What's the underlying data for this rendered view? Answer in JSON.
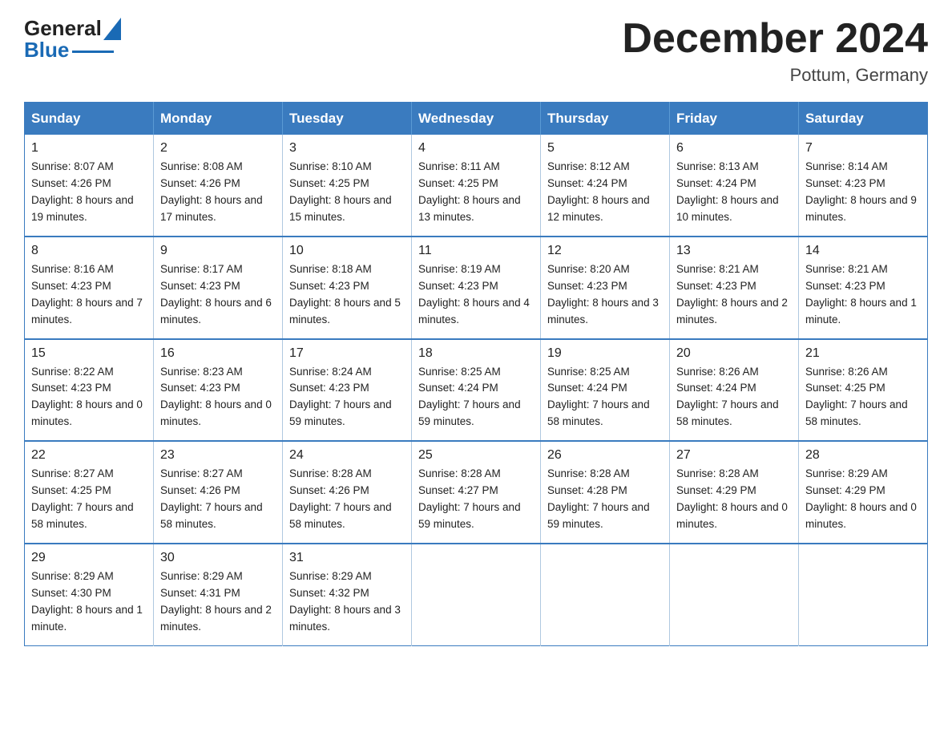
{
  "header": {
    "logo_general": "General",
    "logo_blue": "Blue",
    "month_title": "December 2024",
    "location": "Pottum, Germany"
  },
  "days_of_week": [
    "Sunday",
    "Monday",
    "Tuesday",
    "Wednesday",
    "Thursday",
    "Friday",
    "Saturday"
  ],
  "weeks": [
    [
      {
        "day": "1",
        "sunrise": "8:07 AM",
        "sunset": "4:26 PM",
        "daylight": "8 hours and 19 minutes."
      },
      {
        "day": "2",
        "sunrise": "8:08 AM",
        "sunset": "4:26 PM",
        "daylight": "8 hours and 17 minutes."
      },
      {
        "day": "3",
        "sunrise": "8:10 AM",
        "sunset": "4:25 PM",
        "daylight": "8 hours and 15 minutes."
      },
      {
        "day": "4",
        "sunrise": "8:11 AM",
        "sunset": "4:25 PM",
        "daylight": "8 hours and 13 minutes."
      },
      {
        "day": "5",
        "sunrise": "8:12 AM",
        "sunset": "4:24 PM",
        "daylight": "8 hours and 12 minutes."
      },
      {
        "day": "6",
        "sunrise": "8:13 AM",
        "sunset": "4:24 PM",
        "daylight": "8 hours and 10 minutes."
      },
      {
        "day": "7",
        "sunrise": "8:14 AM",
        "sunset": "4:23 PM",
        "daylight": "8 hours and 9 minutes."
      }
    ],
    [
      {
        "day": "8",
        "sunrise": "8:16 AM",
        "sunset": "4:23 PM",
        "daylight": "8 hours and 7 minutes."
      },
      {
        "day": "9",
        "sunrise": "8:17 AM",
        "sunset": "4:23 PM",
        "daylight": "8 hours and 6 minutes."
      },
      {
        "day": "10",
        "sunrise": "8:18 AM",
        "sunset": "4:23 PM",
        "daylight": "8 hours and 5 minutes."
      },
      {
        "day": "11",
        "sunrise": "8:19 AM",
        "sunset": "4:23 PM",
        "daylight": "8 hours and 4 minutes."
      },
      {
        "day": "12",
        "sunrise": "8:20 AM",
        "sunset": "4:23 PM",
        "daylight": "8 hours and 3 minutes."
      },
      {
        "day": "13",
        "sunrise": "8:21 AM",
        "sunset": "4:23 PM",
        "daylight": "8 hours and 2 minutes."
      },
      {
        "day": "14",
        "sunrise": "8:21 AM",
        "sunset": "4:23 PM",
        "daylight": "8 hours and 1 minute."
      }
    ],
    [
      {
        "day": "15",
        "sunrise": "8:22 AM",
        "sunset": "4:23 PM",
        "daylight": "8 hours and 0 minutes."
      },
      {
        "day": "16",
        "sunrise": "8:23 AM",
        "sunset": "4:23 PM",
        "daylight": "8 hours and 0 minutes."
      },
      {
        "day": "17",
        "sunrise": "8:24 AM",
        "sunset": "4:23 PM",
        "daylight": "7 hours and 59 minutes."
      },
      {
        "day": "18",
        "sunrise": "8:25 AM",
        "sunset": "4:24 PM",
        "daylight": "7 hours and 59 minutes."
      },
      {
        "day": "19",
        "sunrise": "8:25 AM",
        "sunset": "4:24 PM",
        "daylight": "7 hours and 58 minutes."
      },
      {
        "day": "20",
        "sunrise": "8:26 AM",
        "sunset": "4:24 PM",
        "daylight": "7 hours and 58 minutes."
      },
      {
        "day": "21",
        "sunrise": "8:26 AM",
        "sunset": "4:25 PM",
        "daylight": "7 hours and 58 minutes."
      }
    ],
    [
      {
        "day": "22",
        "sunrise": "8:27 AM",
        "sunset": "4:25 PM",
        "daylight": "7 hours and 58 minutes."
      },
      {
        "day": "23",
        "sunrise": "8:27 AM",
        "sunset": "4:26 PM",
        "daylight": "7 hours and 58 minutes."
      },
      {
        "day": "24",
        "sunrise": "8:28 AM",
        "sunset": "4:26 PM",
        "daylight": "7 hours and 58 minutes."
      },
      {
        "day": "25",
        "sunrise": "8:28 AM",
        "sunset": "4:27 PM",
        "daylight": "7 hours and 59 minutes."
      },
      {
        "day": "26",
        "sunrise": "8:28 AM",
        "sunset": "4:28 PM",
        "daylight": "7 hours and 59 minutes."
      },
      {
        "day": "27",
        "sunrise": "8:28 AM",
        "sunset": "4:29 PM",
        "daylight": "8 hours and 0 minutes."
      },
      {
        "day": "28",
        "sunrise": "8:29 AM",
        "sunset": "4:29 PM",
        "daylight": "8 hours and 0 minutes."
      }
    ],
    [
      {
        "day": "29",
        "sunrise": "8:29 AM",
        "sunset": "4:30 PM",
        "daylight": "8 hours and 1 minute."
      },
      {
        "day": "30",
        "sunrise": "8:29 AM",
        "sunset": "4:31 PM",
        "daylight": "8 hours and 2 minutes."
      },
      {
        "day": "31",
        "sunrise": "8:29 AM",
        "sunset": "4:32 PM",
        "daylight": "8 hours and 3 minutes."
      },
      null,
      null,
      null,
      null
    ]
  ]
}
